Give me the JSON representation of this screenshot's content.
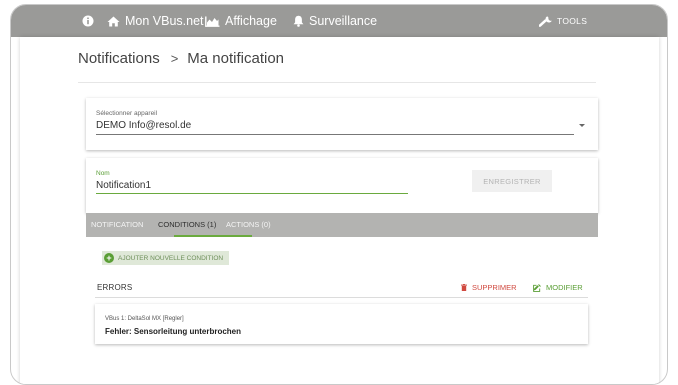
{
  "colors": {
    "navbar": "#9a9a98",
    "accent_green": "#5a9e35",
    "delete_red": "#d0493f",
    "tabbar": "#b3b3b1"
  },
  "navbar": {
    "info_icon": "info-circle-icon",
    "home": {
      "icon": "home-icon",
      "label": "Mon VBus.net"
    },
    "display": {
      "icon": "chart-icon",
      "label": "Affichage"
    },
    "monitoring": {
      "icon": "bell-icon",
      "label": "Surveillance"
    },
    "tools": {
      "icon": "wrench-icon",
      "label": "TOOLS"
    }
  },
  "breadcrumb": {
    "parent": "Notifications",
    "separator": ">",
    "current": "Ma notification"
  },
  "device_select": {
    "label": "Sélectionner appareil",
    "value": "DEMO Info@resol.de",
    "icon": "dropdown-arrow-icon"
  },
  "notification_form": {
    "name_label": "Nom",
    "name_value": "Notification1",
    "save_label": "ENREGISTRER"
  },
  "tabs": [
    {
      "label": "NOTIFICATION",
      "active": false
    },
    {
      "label": "CONDITIONS (1)",
      "active": true
    },
    {
      "label": "ACTIONS (0)",
      "active": false
    }
  ],
  "conditions": {
    "add_label": "AJOUTER NOUVELLE CONDITION",
    "group_title": "ERRORS",
    "delete_label": "SUPPRIMER",
    "modify_label": "MODIFIER",
    "items": [
      {
        "source": "VBus 1: DeltaSol MX [Regler]",
        "message": "Fehler: Sensorleitung unterbrochen"
      }
    ]
  }
}
